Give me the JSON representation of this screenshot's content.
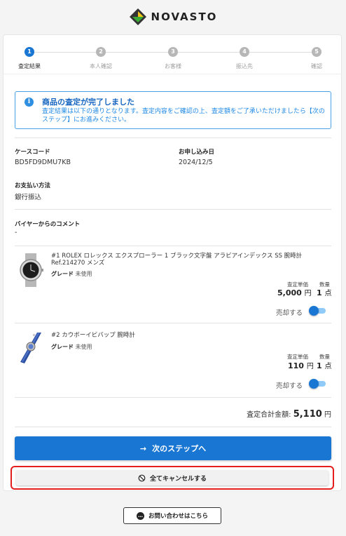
{
  "brand": {
    "name": "NOVASTO",
    "colors": {
      "green": "#3aa935",
      "dark": "#333333"
    }
  },
  "stepper": {
    "steps": [
      {
        "num": "1",
        "label": "査定結果",
        "active": true
      },
      {
        "num": "2",
        "label": "本人確認",
        "active": false
      },
      {
        "num": "3",
        "label": "お客様",
        "active": false
      },
      {
        "num": "4",
        "label": "振込先",
        "active": false
      },
      {
        "num": "5",
        "label": "確認",
        "active": false
      }
    ]
  },
  "notice": {
    "icon": "info-icon",
    "title": "商品の査定が完了しました",
    "body": "査定結果は以下の通りとなります。査定内容をご確認の上、査定額をご了承いただけましたら【次のステップ】にお進みください。"
  },
  "details": {
    "case_code_label": "ケースコード",
    "case_code": "BD5FD9DMU7KB",
    "apply_date_label": "お申し込み日",
    "apply_date": "2024/12/5",
    "payment_label": "お支払い方法",
    "payment": "銀行振込",
    "comment_label": "バイヤーからのコメント",
    "comment": "-"
  },
  "items": [
    {
      "title": "#1 ROLEX ロレックス エクスプローラー 1 ブラック文字盤 アラビアインデックス SS 腕時計 Ref.214270 メンズ",
      "grade_label": "グレード",
      "grade": "未使用",
      "price_head": "査定単価",
      "qty_head": "数量",
      "price": "5,000",
      "price_unit": "円",
      "qty": "1",
      "qty_unit": "点",
      "sell_label": "売却する",
      "sell": true
    },
    {
      "title": "#2 カウボーイビバップ 腕時計",
      "grade_label": "グレード",
      "grade": "未使用",
      "price_head": "査定単価",
      "qty_head": "数量",
      "price": "110",
      "price_unit": "円",
      "qty": "1",
      "qty_unit": "点",
      "sell_label": "売却する",
      "sell": true
    }
  ],
  "total": {
    "label": "査定合計金額:",
    "value": "5,110",
    "unit": "円"
  },
  "actions": {
    "next_label": "次のステップへ",
    "cancel_label": "全てキャンセルする",
    "contact_label": "お問い合わせはこちら"
  }
}
